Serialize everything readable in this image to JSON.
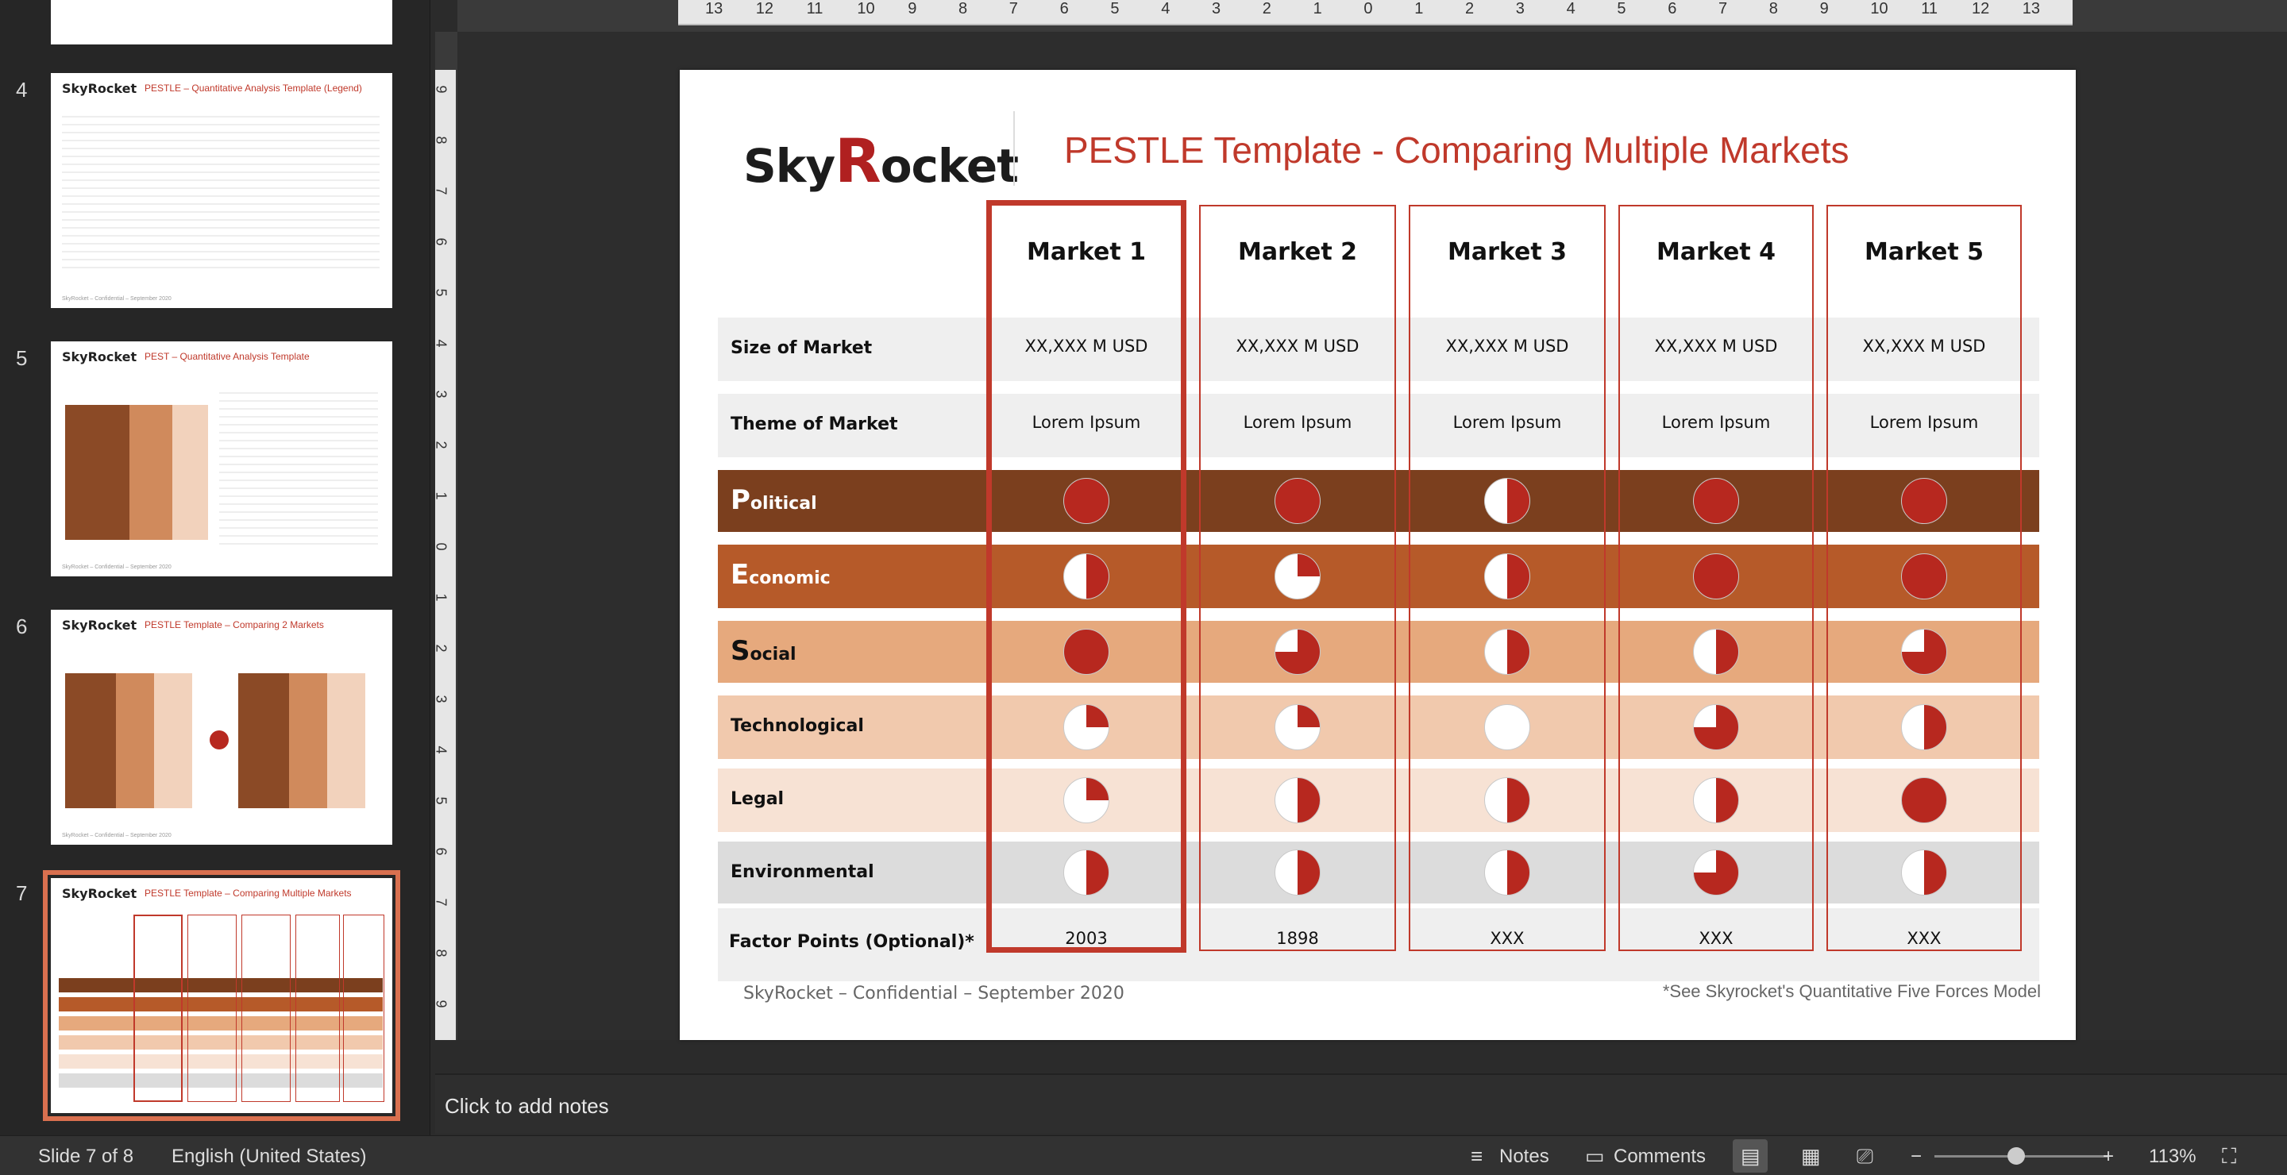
{
  "slide_panel": {
    "thumbnails": [
      {
        "num": "4",
        "title": "PESTLE – Quantitative Analysis Template (Legend)"
      },
      {
        "num": "5",
        "title": "PEST – Quantitative Analysis Template"
      },
      {
        "num": "6",
        "title": "PESTLE Template – Comparing 2 Markets"
      },
      {
        "num": "7",
        "title": "PESTLE Template – Comparing Multiple Markets"
      }
    ],
    "logo_text": "SkyRocket",
    "footer": "SkyRocket – Confidential – September 2020"
  },
  "ruler": {
    "h_ticks": [
      "13",
      "12",
      "11",
      "10",
      "9",
      "8",
      "7",
      "6",
      "5",
      "4",
      "3",
      "2",
      "1",
      "0",
      "1",
      "2",
      "3",
      "4",
      "5",
      "6",
      "7",
      "8",
      "9",
      "10",
      "11",
      "12",
      "13"
    ],
    "v_ticks": [
      "9",
      "8",
      "7",
      "6",
      "5",
      "4",
      "3",
      "2",
      "1",
      "0",
      "1",
      "2",
      "3",
      "4",
      "5",
      "6",
      "7",
      "8",
      "9"
    ]
  },
  "slide": {
    "logo_a": "Sky",
    "logo_r": "R",
    "logo_b": "ocket",
    "title": "PESTLE Template - Comparing Multiple Markets",
    "markets": [
      "Market 1",
      "Market 2",
      "Market 3",
      "Market 4",
      "Market 5"
    ],
    "rows": {
      "size": {
        "label": "Size of Market",
        "values": [
          "XX,XXX M USD",
          "XX,XXX M USD",
          "XX,XXX M USD",
          "XX,XXX M USD",
          "XX,XXX M USD"
        ]
      },
      "theme": {
        "label": "Theme of Market",
        "values": [
          "Lorem Ipsum",
          "Lorem Ipsum",
          "Lorem Ipsum",
          "Lorem Ipsum",
          "Lorem Ipsum"
        ]
      },
      "factors": {
        "label": "Factor Points (Optional)*",
        "values": [
          "2003",
          "1898",
          "XXX",
          "XXX",
          "XXX"
        ]
      }
    },
    "pestle": [
      {
        "first": "P",
        "rest": "olitical",
        "label": "Political",
        "fills": [
          1,
          1,
          0.5,
          1,
          1
        ]
      },
      {
        "first": "E",
        "rest": "conomic",
        "label": "Economic",
        "fills": [
          0.5,
          0.25,
          0.5,
          1,
          1
        ]
      },
      {
        "first": "S",
        "rest": "ocial",
        "label": "Social",
        "fills": [
          1,
          0.75,
          0.5,
          0.5,
          0.75
        ]
      },
      {
        "first": "",
        "rest": "Technological",
        "label": "Technological",
        "fills": [
          0.25,
          0.25,
          0,
          0.75,
          0.5
        ]
      },
      {
        "first": "",
        "rest": "Legal",
        "label": "Legal",
        "fills": [
          0.25,
          0.5,
          0.5,
          0.5,
          1
        ]
      },
      {
        "first": "",
        "rest": "Environmental",
        "label": "Environmental",
        "fills": [
          0.5,
          0.5,
          0.5,
          0.75,
          0.5
        ]
      }
    ],
    "footer_left": "SkyRocket – Confidential – September 2020",
    "footer_right": "*See Skyrocket's Quantitative Five Forces Model"
  },
  "notes": {
    "placeholder": "Click to add notes"
  },
  "status_bar": {
    "slide_info": "Slide 7 of 8",
    "language": "English (United States)",
    "notes_label": "Notes",
    "comments_label": "Comments",
    "zoom_minus": "−",
    "zoom_plus": "+",
    "zoom": "113%"
  },
  "colors": {
    "accent": "#c0392b",
    "pie_fill": "#b7281f",
    "political": "#7b3f1e",
    "economic": "#b65a29",
    "social": "#e6a97d",
    "technological": "#f1c9ad",
    "legal": "#f7e2d4",
    "environmental": "#dcdcdc",
    "info_row": "#efefef"
  }
}
